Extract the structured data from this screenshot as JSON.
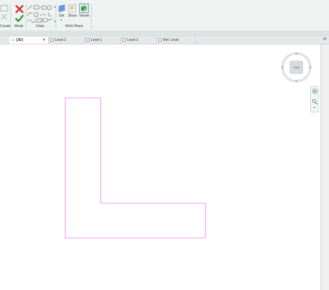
{
  "ribbon": {
    "create_label": "Create",
    "mode_label": "Mode",
    "draw_label": "Draw",
    "work_plane_label": "Work Plane",
    "set_label": "Set",
    "show_label": "Show",
    "viewer_label": "Viewer"
  },
  "tabs": [
    {
      "label": "{3D}",
      "icon": "home-icon",
      "active": true
    },
    {
      "label": "Level 2",
      "icon": "floor-plan-icon"
    },
    {
      "label": "Level 1",
      "icon": "floor-plan-icon"
    },
    {
      "label": "Level 3",
      "icon": "floor-plan-icon"
    },
    {
      "label": "Ref. Level",
      "icon": "floor-plan-icon"
    }
  ],
  "tab_close": "×",
  "viewcube": {
    "face_label": "TOP"
  },
  "properties_label": "Pr",
  "colors": {
    "sketch_line": "#e57ce6",
    "finish_check": "#2e9b2e",
    "cancel_x": "#d62b2b",
    "ribbon_bg": "#eef3f2",
    "accent_blue": "#2f6fb3"
  }
}
